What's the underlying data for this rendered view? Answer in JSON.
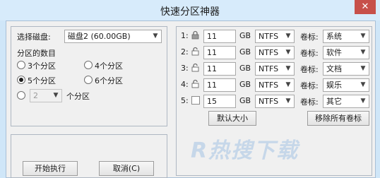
{
  "window": {
    "title": "快速分区神器",
    "close_glyph": "✕"
  },
  "disk": {
    "label": "选择磁盘:",
    "selected": "磁盘2 (60.00GB)"
  },
  "partition_count": {
    "label": "分区的数目",
    "options": [
      "3个分区",
      "4个分区",
      "5个分区",
      "6个分区"
    ],
    "selected": "5个分区",
    "custom_value": "2",
    "custom_suffix": "个分区"
  },
  "partitions": [
    {
      "index": "1:",
      "size": "11",
      "unit": "GB",
      "fs": "NTFS",
      "label_caption": "卷标:",
      "volume": "系统"
    },
    {
      "index": "2:",
      "size": "11",
      "unit": "GB",
      "fs": "NTFS",
      "label_caption": "卷标:",
      "volume": "软件"
    },
    {
      "index": "3:",
      "size": "11",
      "unit": "GB",
      "fs": "NTFS",
      "label_caption": "卷标:",
      "volume": "文档"
    },
    {
      "index": "4:",
      "size": "11",
      "unit": "GB",
      "fs": "NTFS",
      "label_caption": "卷标:",
      "volume": "娱乐"
    },
    {
      "index": "5:",
      "size": "15",
      "unit": "GB",
      "fs": "NTFS",
      "label_caption": "卷标:",
      "volume": "其它"
    }
  ],
  "buttons": {
    "default_size": "默认大小",
    "remove_labels": "移除所有卷标",
    "start": "开始执行",
    "cancel": "取消(C)"
  },
  "watermark": "R热搜下载"
}
